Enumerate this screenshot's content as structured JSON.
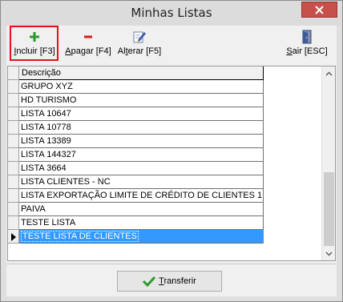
{
  "window": {
    "title": "Minhas Listas"
  },
  "toolbar": {
    "incluir_prefix": "I",
    "incluir_rest": "ncluir [F3]",
    "apagar_prefix": "A",
    "apagar_rest": "pagar [F4]",
    "alterar_prefix": "Al",
    "alterar_mid": "t",
    "alterar_rest": "erar [F5]",
    "sair_prefix": "S",
    "sair_rest": "air [ESC]"
  },
  "grid": {
    "column_header": "Descrição",
    "rows": [
      "GRUPO XYZ",
      "HD TURISMO",
      "LISTA 10647",
      "LISTA 10778",
      "LISTA 13389",
      "LISTA 144327",
      "LISTA 3664",
      "LISTA CLIENTES - NC",
      "LISTA EXPORTAÇÃO LIMITE DE CRÉDITO DE CLIENTES 1",
      "PAIVA",
      "TESTE LISTA",
      "TESTE LISTA DE CLIENTES"
    ],
    "selected_index": 11
  },
  "footer": {
    "transfer_prefix": "T",
    "transfer_rest": "ransferir"
  },
  "colors": {
    "selection": "#3399ff",
    "highlight_border": "#e8101a",
    "close_button": "#c7504a"
  },
  "icons": {
    "incluir": "plus-icon",
    "apagar": "minus-icon",
    "alterar": "edit-icon",
    "sair": "exit-door-icon",
    "transfer": "checkmark-icon"
  }
}
